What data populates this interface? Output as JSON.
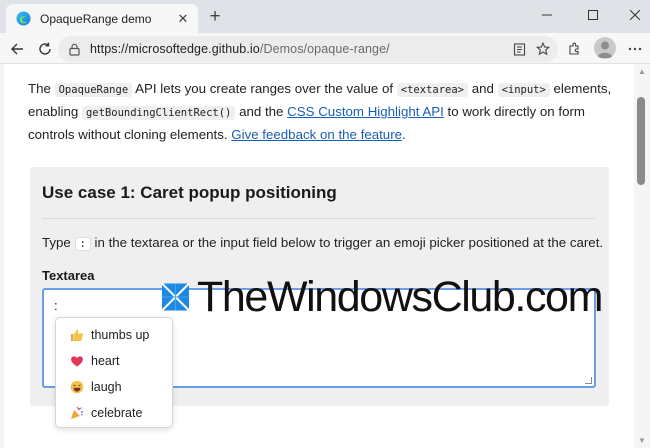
{
  "browser": {
    "tab_title": "OpaqueRange demo",
    "url_host": "https://microsoftedge.github.io",
    "url_path": "/Demos/opaque-range/",
    "accent": "#1a5fb4"
  },
  "intro": {
    "t1": "The ",
    "code1": "OpaqueRange",
    "t2": " API lets you create ranges over the value of ",
    "code2": "<textarea>",
    "t3": " and ",
    "code3": "<input>",
    "t4": " elements, enabling ",
    "code4": "getBoundingClientRect()",
    "t5": " and the ",
    "link1": "CSS Custom Highlight API",
    "t6": " to work directly on form controls without cloning elements. ",
    "link2": "Give feedback on the feature",
    "t7": "."
  },
  "use_case": {
    "title": "Use case 1: Caret popup positioning",
    "desc_before": "Type ",
    "desc_code": ":",
    "desc_after": " in the textarea or the input field below to trigger an emoji picker positioned at the caret.",
    "textarea_label": "Textarea",
    "textarea_value": ":"
  },
  "emoji_picker": {
    "items": [
      {
        "label": "thumbs up",
        "icon": "thumbs-up-icon"
      },
      {
        "label": "heart",
        "icon": "heart-icon"
      },
      {
        "label": "laugh",
        "icon": "laugh-icon"
      },
      {
        "label": "celebrate",
        "icon": "party-popper-icon"
      }
    ]
  },
  "watermark": {
    "text": "TheWindowsClub.com"
  }
}
